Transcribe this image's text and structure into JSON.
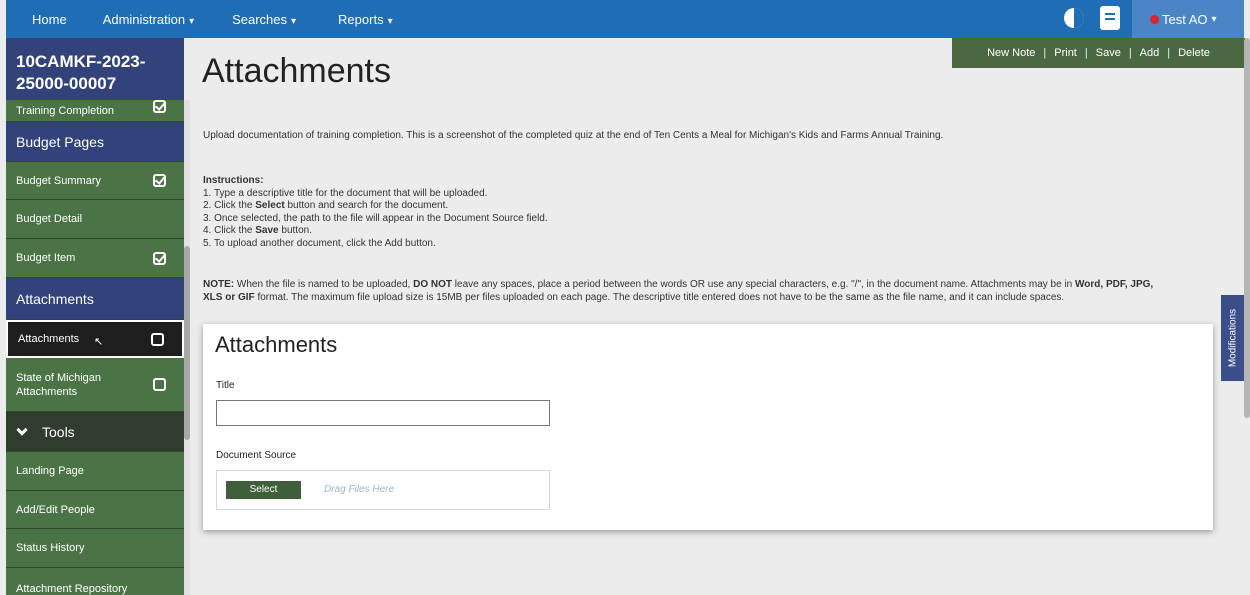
{
  "topnav": {
    "items": [
      {
        "label": "Home",
        "caret": ""
      },
      {
        "label": "Administration",
        "caret": "▾"
      },
      {
        "label": "Searches",
        "caret": "▾"
      },
      {
        "label": "Reports",
        "caret": "▾"
      }
    ],
    "user": "Test AO",
    "user_caret": "▾",
    "colors": {
      "bar": "#1f6db4",
      "user_bg": "#4a86c5",
      "status_dot": "#d9262b"
    }
  },
  "sidebar": {
    "app_id_line1": "10CAMKF-2023-",
    "app_id_line2": "25000-00007",
    "items": [
      {
        "label": "Training Completion",
        "check": "done"
      },
      {
        "label": "Budget Pages"
      },
      {
        "label": "Budget Summary",
        "check": "done"
      },
      {
        "label": "Budget Detail"
      },
      {
        "label": "Budget Item",
        "check": "done"
      },
      {
        "label": "Attachments"
      },
      {
        "label": "Attachments",
        "check": "empty"
      },
      {
        "label": "State of Michigan Attachments",
        "check": "empty"
      },
      {
        "label": "Tools"
      },
      {
        "label": "Landing Page"
      },
      {
        "label": "Add/Edit People"
      },
      {
        "label": "Status History"
      },
      {
        "label": "Attachment Repository"
      }
    ],
    "colors": {
      "green": "#4b7446",
      "section": "#31437a",
      "tools": "#2f3e2c"
    }
  },
  "page": {
    "title": "Attachments",
    "actions": [
      "New Note",
      "Print",
      "Save",
      "Add",
      "Delete"
    ],
    "action_separator": "|",
    "description": "Upload documentation of training completion. This is a screenshot of the completed quiz at the end of Ten Cents a Meal for Michigan's Kids and Farms Annual Training.",
    "instructions_heading": "Instructions:",
    "instructions": {
      "s1": "1. Type a descriptive title for the document that will be uploaded.",
      "s2_pre": "2. Click the ",
      "s2_bold": "Select",
      "s2_post": " button and search for the document.",
      "s3": "3. Once selected, the path to the file will appear in the Document Source field.",
      "s4_pre": "4. Click the ",
      "s4_bold": "Save",
      "s4_post": " button.",
      "s5": "5. To upload another document, click the Add button."
    },
    "note": {
      "label": "NOTE:",
      "p1": " When the file is named to be uploaded, ",
      "b1": "DO NOT",
      "p2": " leave any spaces, place a period between the words OR use any special characters, e.g. \"/\", in the document name. Attachments may be in ",
      "b2": "Word, PDF, JPG, XLS or GIF",
      "p3": " format. The maximum file upload size is 15MB per files uploaded on each page. The descriptive title entered does not have to be the same as the file name, and it can include spaces."
    },
    "modifications_tab": "Modifications"
  },
  "form": {
    "title": "Attachments",
    "title_label": "Title",
    "title_value": "",
    "source_label": "Document Source",
    "select_button": "Select",
    "drag_hint": "Drag Files Here"
  }
}
